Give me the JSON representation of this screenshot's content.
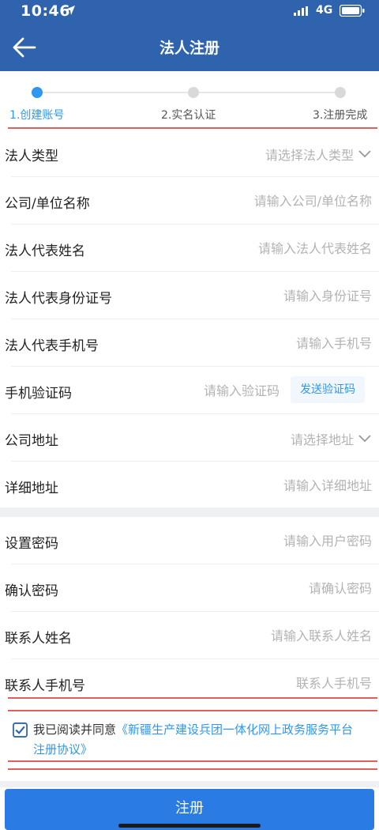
{
  "status_bar": {
    "time": "10:46",
    "network": "4G"
  },
  "nav": {
    "title": "法人注册"
  },
  "steps": [
    {
      "label": "1.创建账号",
      "active": true
    },
    {
      "label": "2.实名认证",
      "active": false
    },
    {
      "label": "3.注册完成",
      "active": false
    }
  ],
  "form": {
    "legal_type": {
      "label": "法人类型",
      "placeholder": "请选择法人类型"
    },
    "company_name": {
      "label": "公司/单位名称",
      "placeholder": "请输入公司/单位名称"
    },
    "rep_name": {
      "label": "法人代表姓名",
      "placeholder": "请输入法人代表姓名"
    },
    "rep_id": {
      "label": "法人代表身份证号",
      "placeholder": "请输入身份证号"
    },
    "rep_phone": {
      "label": "法人代表手机号",
      "placeholder": "请输入手机号"
    },
    "sms_code": {
      "label": "手机验证码",
      "placeholder": "请输入验证码",
      "button": "发送验证码"
    },
    "company_address": {
      "label": "公司地址",
      "placeholder": "请选择地址"
    },
    "detail_address": {
      "label": "详细地址",
      "placeholder": "请输入详细地址"
    },
    "password": {
      "label": "设置密码",
      "placeholder": "请输入用户密码"
    },
    "confirm_password": {
      "label": "确认密码",
      "placeholder": "请确认密码"
    },
    "contact_name": {
      "label": "联系人姓名",
      "placeholder": "请输入联系人姓名"
    },
    "contact_phone": {
      "label": "联系人手机号",
      "placeholder": "联系人手机号"
    }
  },
  "agreement": {
    "prefix": "我已阅读并同意",
    "link": "《新疆生产建设兵团一体化网上政务服务平台注册协议》",
    "checked": true
  },
  "register_button": "注册",
  "colors": {
    "primary": "#2f63ad",
    "accent": "#2f97f1",
    "button": "#2a7be4"
  }
}
